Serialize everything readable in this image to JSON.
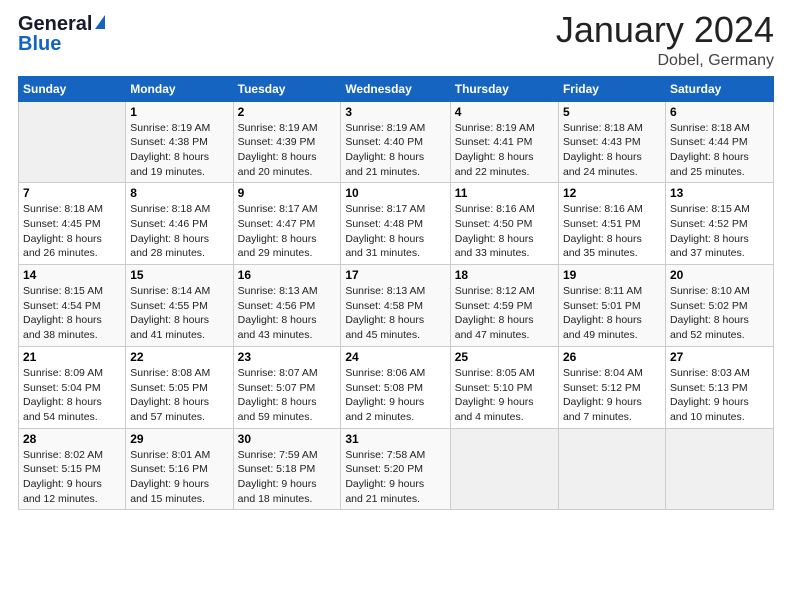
{
  "header": {
    "title": "January 2024",
    "location": "Dobel, Germany"
  },
  "columns": [
    "Sunday",
    "Monday",
    "Tuesday",
    "Wednesday",
    "Thursday",
    "Friday",
    "Saturday"
  ],
  "weeks": [
    [
      {
        "day": "",
        "detail": ""
      },
      {
        "day": "1",
        "detail": "Sunrise: 8:19 AM\nSunset: 4:38 PM\nDaylight: 8 hours\nand 19 minutes."
      },
      {
        "day": "2",
        "detail": "Sunrise: 8:19 AM\nSunset: 4:39 PM\nDaylight: 8 hours\nand 20 minutes."
      },
      {
        "day": "3",
        "detail": "Sunrise: 8:19 AM\nSunset: 4:40 PM\nDaylight: 8 hours\nand 21 minutes."
      },
      {
        "day": "4",
        "detail": "Sunrise: 8:19 AM\nSunset: 4:41 PM\nDaylight: 8 hours\nand 22 minutes."
      },
      {
        "day": "5",
        "detail": "Sunrise: 8:18 AM\nSunset: 4:43 PM\nDaylight: 8 hours\nand 24 minutes."
      },
      {
        "day": "6",
        "detail": "Sunrise: 8:18 AM\nSunset: 4:44 PM\nDaylight: 8 hours\nand 25 minutes."
      }
    ],
    [
      {
        "day": "7",
        "detail": "Sunrise: 8:18 AM\nSunset: 4:45 PM\nDaylight: 8 hours\nand 26 minutes."
      },
      {
        "day": "8",
        "detail": "Sunrise: 8:18 AM\nSunset: 4:46 PM\nDaylight: 8 hours\nand 28 minutes."
      },
      {
        "day": "9",
        "detail": "Sunrise: 8:17 AM\nSunset: 4:47 PM\nDaylight: 8 hours\nand 29 minutes."
      },
      {
        "day": "10",
        "detail": "Sunrise: 8:17 AM\nSunset: 4:48 PM\nDaylight: 8 hours\nand 31 minutes."
      },
      {
        "day": "11",
        "detail": "Sunrise: 8:16 AM\nSunset: 4:50 PM\nDaylight: 8 hours\nand 33 minutes."
      },
      {
        "day": "12",
        "detail": "Sunrise: 8:16 AM\nSunset: 4:51 PM\nDaylight: 8 hours\nand 35 minutes."
      },
      {
        "day": "13",
        "detail": "Sunrise: 8:15 AM\nSunset: 4:52 PM\nDaylight: 8 hours\nand 37 minutes."
      }
    ],
    [
      {
        "day": "14",
        "detail": "Sunrise: 8:15 AM\nSunset: 4:54 PM\nDaylight: 8 hours\nand 38 minutes."
      },
      {
        "day": "15",
        "detail": "Sunrise: 8:14 AM\nSunset: 4:55 PM\nDaylight: 8 hours\nand 41 minutes."
      },
      {
        "day": "16",
        "detail": "Sunrise: 8:13 AM\nSunset: 4:56 PM\nDaylight: 8 hours\nand 43 minutes."
      },
      {
        "day": "17",
        "detail": "Sunrise: 8:13 AM\nSunset: 4:58 PM\nDaylight: 8 hours\nand 45 minutes."
      },
      {
        "day": "18",
        "detail": "Sunrise: 8:12 AM\nSunset: 4:59 PM\nDaylight: 8 hours\nand 47 minutes."
      },
      {
        "day": "19",
        "detail": "Sunrise: 8:11 AM\nSunset: 5:01 PM\nDaylight: 8 hours\nand 49 minutes."
      },
      {
        "day": "20",
        "detail": "Sunrise: 8:10 AM\nSunset: 5:02 PM\nDaylight: 8 hours\nand 52 minutes."
      }
    ],
    [
      {
        "day": "21",
        "detail": "Sunrise: 8:09 AM\nSunset: 5:04 PM\nDaylight: 8 hours\nand 54 minutes."
      },
      {
        "day": "22",
        "detail": "Sunrise: 8:08 AM\nSunset: 5:05 PM\nDaylight: 8 hours\nand 57 minutes."
      },
      {
        "day": "23",
        "detail": "Sunrise: 8:07 AM\nSunset: 5:07 PM\nDaylight: 8 hours\nand 59 minutes."
      },
      {
        "day": "24",
        "detail": "Sunrise: 8:06 AM\nSunset: 5:08 PM\nDaylight: 9 hours\nand 2 minutes."
      },
      {
        "day": "25",
        "detail": "Sunrise: 8:05 AM\nSunset: 5:10 PM\nDaylight: 9 hours\nand 4 minutes."
      },
      {
        "day": "26",
        "detail": "Sunrise: 8:04 AM\nSunset: 5:12 PM\nDaylight: 9 hours\nand 7 minutes."
      },
      {
        "day": "27",
        "detail": "Sunrise: 8:03 AM\nSunset: 5:13 PM\nDaylight: 9 hours\nand 10 minutes."
      }
    ],
    [
      {
        "day": "28",
        "detail": "Sunrise: 8:02 AM\nSunset: 5:15 PM\nDaylight: 9 hours\nand 12 minutes."
      },
      {
        "day": "29",
        "detail": "Sunrise: 8:01 AM\nSunset: 5:16 PM\nDaylight: 9 hours\nand 15 minutes."
      },
      {
        "day": "30",
        "detail": "Sunrise: 7:59 AM\nSunset: 5:18 PM\nDaylight: 9 hours\nand 18 minutes."
      },
      {
        "day": "31",
        "detail": "Sunrise: 7:58 AM\nSunset: 5:20 PM\nDaylight: 9 hours\nand 21 minutes."
      },
      {
        "day": "",
        "detail": ""
      },
      {
        "day": "",
        "detail": ""
      },
      {
        "day": "",
        "detail": ""
      }
    ]
  ]
}
